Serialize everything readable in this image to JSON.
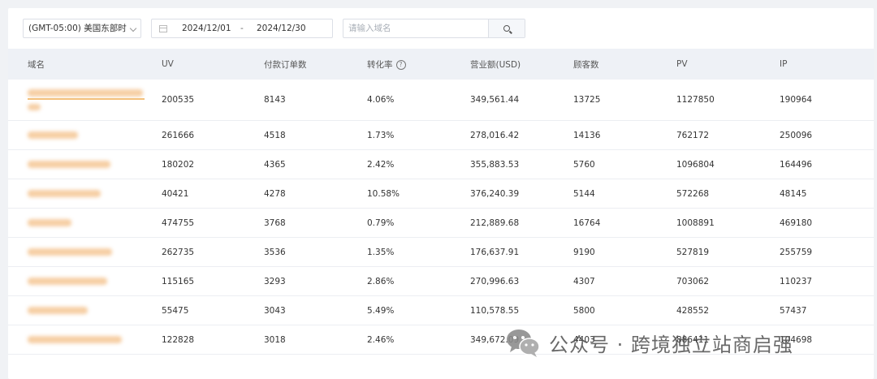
{
  "filters": {
    "timezone": "(GMT-05:00) 美国东部时",
    "date_start": "2024/12/01",
    "date_separator": "-",
    "date_end": "2024/12/30",
    "search_placeholder": "请输入域名"
  },
  "table": {
    "columns": [
      "域名",
      "UV",
      "付款订单数",
      "转化率",
      "营业额(USD)",
      "顾客数",
      "PV",
      "IP"
    ],
    "rows": [
      {
        "uv": "200535",
        "orders": "8143",
        "conversion": "4.06%",
        "revenue": "349,561.44",
        "customers": "13725",
        "pv": "1127850",
        "ip": "190964"
      },
      {
        "uv": "261666",
        "orders": "4518",
        "conversion": "1.73%",
        "revenue": "278,016.42",
        "customers": "14136",
        "pv": "762172",
        "ip": "250096"
      },
      {
        "uv": "180202",
        "orders": "4365",
        "conversion": "2.42%",
        "revenue": "355,883.53",
        "customers": "5760",
        "pv": "1096804",
        "ip": "164496"
      },
      {
        "uv": "40421",
        "orders": "4278",
        "conversion": "10.58%",
        "revenue": "376,240.39",
        "customers": "5144",
        "pv": "572268",
        "ip": "48145"
      },
      {
        "uv": "474755",
        "orders": "3768",
        "conversion": "0.79%",
        "revenue": "212,889.68",
        "customers": "16764",
        "pv": "1008891",
        "ip": "469180"
      },
      {
        "uv": "262735",
        "orders": "3536",
        "conversion": "1.35%",
        "revenue": "176,637.91",
        "customers": "9190",
        "pv": "527819",
        "ip": "255759"
      },
      {
        "uv": "115165",
        "orders": "3293",
        "conversion": "2.86%",
        "revenue": "270,996.63",
        "customers": "4307",
        "pv": "703062",
        "ip": "110237"
      },
      {
        "uv": "55475",
        "orders": "3043",
        "conversion": "5.49%",
        "revenue": "110,578.55",
        "customers": "5800",
        "pv": "428552",
        "ip": "57437"
      },
      {
        "uv": "122828",
        "orders": "3018",
        "conversion": "2.46%",
        "revenue": "349,672.09",
        "customers": "4403",
        "pv": "886411",
        "ip": "104698"
      }
    ]
  },
  "watermark": {
    "text": "公众号 · 跨境独立站商启强",
    "icon": "wechat-logo-icon"
  },
  "colors": {
    "header_bg": "#eef1f6",
    "page_bg": "#f0f2f5",
    "blurred_domain": "#f5c99a"
  }
}
